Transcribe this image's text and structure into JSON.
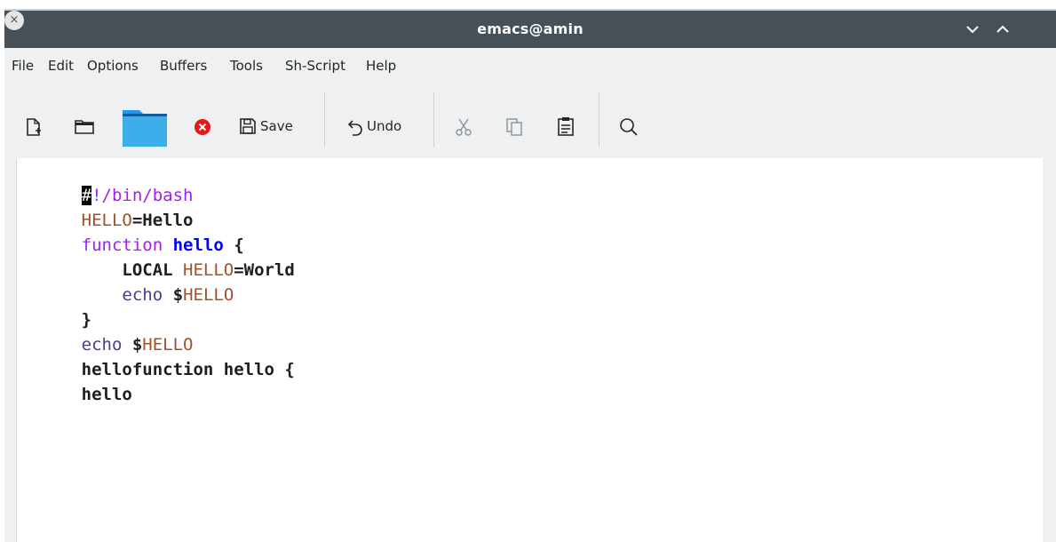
{
  "window": {
    "title": "emacs@amin",
    "close_glyph": "×"
  },
  "menu": [
    "File",
    "Edit",
    "Options",
    "Buffers",
    "Tools",
    "Sh-Script",
    "Help"
  ],
  "toolbar": {
    "save_label": "Save",
    "undo_label": "Undo",
    "icons": [
      "new-file-icon",
      "open-directory-icon",
      "folder-icon",
      "kill-buffer-icon",
      "save-icon",
      "undo-icon",
      "cut-icon",
      "copy-icon",
      "paste-icon",
      "search-icon"
    ]
  },
  "editor": {
    "lines": [
      {
        "tokens": [
          {
            "t": "#",
            "c": "cursor"
          },
          {
            "t": "!/bin/bash",
            "c": "kw"
          }
        ]
      },
      {
        "tokens": [
          {
            "t": "HELLO",
            "c": "var"
          },
          {
            "t": "=Hello",
            "c": "bold"
          }
        ]
      },
      {
        "tokens": [
          {
            "t": "function",
            "c": "kw"
          },
          {
            "t": " ",
            "c": ""
          },
          {
            "t": "hello",
            "c": "fn"
          },
          {
            "t": " {",
            "c": "bold"
          }
        ]
      },
      {
        "tokens": [
          {
            "t": "    LOCAL ",
            "c": "bold"
          },
          {
            "t": "HELLO",
            "c": "var"
          },
          {
            "t": "=World",
            "c": "bold"
          }
        ]
      },
      {
        "tokens": [
          {
            "t": "    ",
            "c": ""
          },
          {
            "t": "echo",
            "c": "bi"
          },
          {
            "t": " $",
            "c": "bold"
          },
          {
            "t": "HELLO",
            "c": "var"
          }
        ]
      },
      {
        "tokens": [
          {
            "t": "}",
            "c": "bold"
          }
        ]
      },
      {
        "tokens": [
          {
            "t": "echo",
            "c": "bi"
          },
          {
            "t": " $",
            "c": "bold"
          },
          {
            "t": "HELLO",
            "c": "var"
          }
        ]
      },
      {
        "tokens": [
          {
            "t": "hellofunction hello {",
            "c": "bold"
          }
        ]
      },
      {
        "tokens": [
          {
            "t": "hello",
            "c": "bold"
          }
        ]
      }
    ]
  },
  "colors": {
    "titlebar": "#475057",
    "keyword": "#a020f0",
    "function_name": "#0000ff",
    "variable": "#a0522d",
    "builtin": "#483d8b"
  }
}
